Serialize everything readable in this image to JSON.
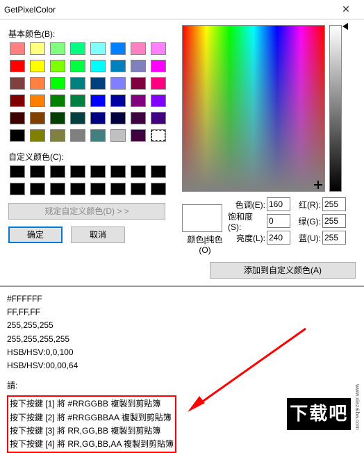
{
  "window": {
    "title": "GetPixelColor"
  },
  "labels": {
    "basic": "基本颜色(B):",
    "custom": "自定义颜色(C):",
    "define": "规定自定义颜色(D) > >",
    "ok": "确定",
    "cancel": "取消",
    "addcustom": "添加到自定义颜色(A)",
    "pure": "颜色|纯色(O)",
    "hue": "色调(E):",
    "sat": "饱和度(S):",
    "lum": "亮度(L):",
    "red": "红(R):",
    "green": "绿(G):",
    "blue": "蓝(U):"
  },
  "values": {
    "hue": "160",
    "sat": "0",
    "lum": "240",
    "red": "255",
    "green": "255",
    "blue": "255"
  },
  "basic_colors": [
    "#ff8080",
    "#ffff80",
    "#80ff80",
    "#00ff80",
    "#80ffff",
    "#0080ff",
    "#ff80c0",
    "#ff80ff",
    "#ff0000",
    "#ffff00",
    "#80ff00",
    "#00ff40",
    "#00ffff",
    "#0080c0",
    "#8080c0",
    "#ff00ff",
    "#804040",
    "#ff8040",
    "#00ff00",
    "#008080",
    "#004080",
    "#8080ff",
    "#800040",
    "#ff0080",
    "#800000",
    "#ff8000",
    "#008000",
    "#008040",
    "#0000ff",
    "#0000a0",
    "#800080",
    "#8000ff",
    "#400000",
    "#804000",
    "#004000",
    "#004040",
    "#000080",
    "#000040",
    "#400040",
    "#400080",
    "#000000",
    "#808000",
    "#808040",
    "#808080",
    "#408080",
    "#c0c0c0",
    "#400040",
    "#ffffff"
  ],
  "selected_index": 47,
  "custom_colors": [
    "#000000",
    "#000000",
    "#000000",
    "#000000",
    "#000000",
    "#000000",
    "#000000",
    "#000000",
    "#000000",
    "#000000",
    "#000000",
    "#000000",
    "#000000",
    "#000000",
    "#000000",
    "#000000"
  ],
  "output": {
    "lines": [
      "#FFFFFF",
      "FF,FF,FF",
      "255,255,255",
      "255,255,255,255",
      "HSB/HSV:0,0,100",
      "HSB/HSV:00,00,64"
    ],
    "hints_label": "請:",
    "hints": [
      "按下按鍵 [1] 將 #RRGGBB 複製到剪貼簿",
      "按下按鍵 [2] 將 #RRGGBBAA 複製到剪貼簿",
      "按下按鍵 [3] 將 RR,GG,BB 複製到剪貼簿",
      "按下按鍵 [4] 將 RR,GG,BB,AA 複製到剪貼簿"
    ]
  },
  "watermark": {
    "text": "下载吧",
    "url": "www.xiazaiba.com"
  }
}
